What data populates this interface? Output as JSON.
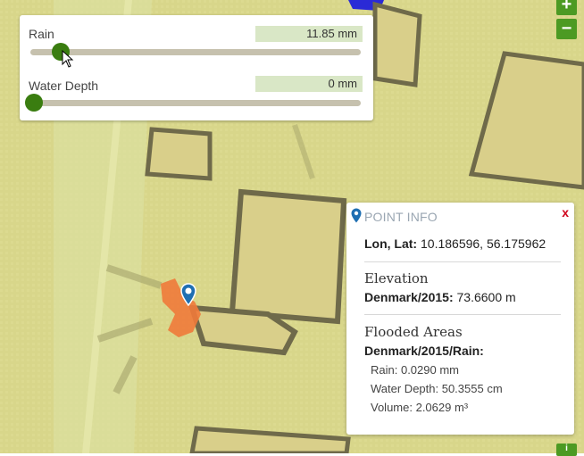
{
  "sliders": {
    "rain": {
      "label": "Rain",
      "value": "11.85 mm",
      "level": 0.08
    },
    "water_depth": {
      "label": "Water Depth",
      "value": "0 mm",
      "level": 0.0
    }
  },
  "zoom": {
    "in": "+",
    "out": "−"
  },
  "popup": {
    "title": "POINT INFO",
    "close": "x",
    "lonlat_label": "Lon, Lat:",
    "lonlat_value": "10.186596, 56.175962",
    "elevation_heading": "Elevation",
    "elevation_source": "Denmark/2015:",
    "elevation_value": "73.6600 m",
    "flood_heading": "Flooded Areas",
    "flood_source": "Denmark/2015/Rain:",
    "rain": "Rain: 0.0290 mm",
    "water_depth": "Water Depth: 50.3555 cm",
    "volume": "Volume: 2.0629 m³"
  },
  "colors": {
    "accent": "#3a7d10",
    "zoom": "#4c9a23",
    "flood": "#f07a3a",
    "value_box": "#d9e7c6",
    "close": "#d0021b"
  },
  "icons": {
    "marker": "map-marker-icon",
    "popup_pin": "pin-icon",
    "cursor": "mouse-cursor-icon"
  }
}
